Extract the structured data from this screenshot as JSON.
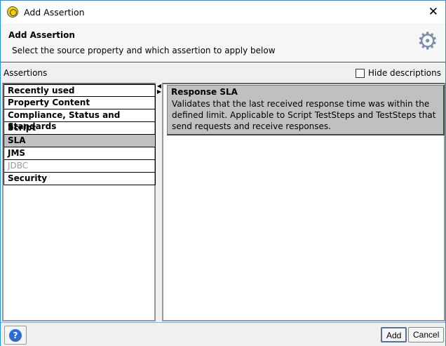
{
  "window": {
    "title": "Add Assertion"
  },
  "header": {
    "title": "Add Assertion",
    "subtitle": "Select the source property and which assertion to apply below"
  },
  "assertions_label": "Assertions",
  "hide_descriptions": {
    "label": "Hide descriptions",
    "checked": false
  },
  "categories": [
    {
      "label": "Recently used"
    },
    {
      "label": "Property Content"
    },
    {
      "label": "Compliance, Status and Standards"
    },
    {
      "label": "Script"
    },
    {
      "label": "SLA",
      "selected": true
    },
    {
      "label": "JMS"
    },
    {
      "label": "JDBC",
      "disabled": true
    },
    {
      "label": "Security"
    }
  ],
  "assertion": {
    "title": "Response SLA",
    "description": "Validates that the last received response time was within the defined limit. Applicable to Script TestSteps and TestSteps that send requests and receive responses."
  },
  "footer": {
    "help": "?",
    "add": "Add",
    "cancel": "Cancel"
  }
}
